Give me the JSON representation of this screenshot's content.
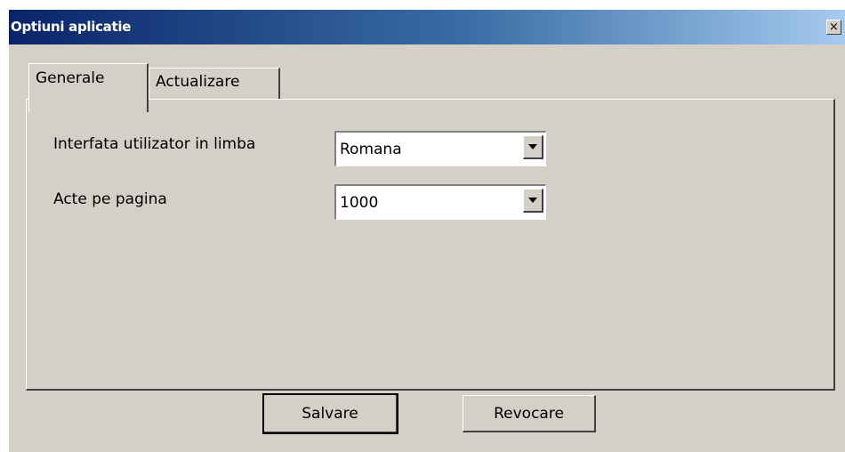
{
  "window": {
    "title": "Optiuni aplicatie",
    "close_symbol": "×"
  },
  "tabs": [
    {
      "label": "Generale",
      "selected": true
    },
    {
      "label": "Actualizare",
      "selected": false
    }
  ],
  "fields": {
    "language": {
      "label": "Interfata utilizator in limba",
      "value": "Romana"
    },
    "acts_per_page": {
      "label": "Acte pe pagina",
      "value": "1000"
    }
  },
  "buttons": {
    "save": "Salvare",
    "cancel": "Revocare"
  },
  "icons": {
    "close": "close-icon",
    "dropdown": "chevron-down-icon"
  },
  "colors": {
    "titlebar_start": "#0a246a",
    "titlebar_end": "#a6caf0",
    "face": "#d4d0c8"
  }
}
